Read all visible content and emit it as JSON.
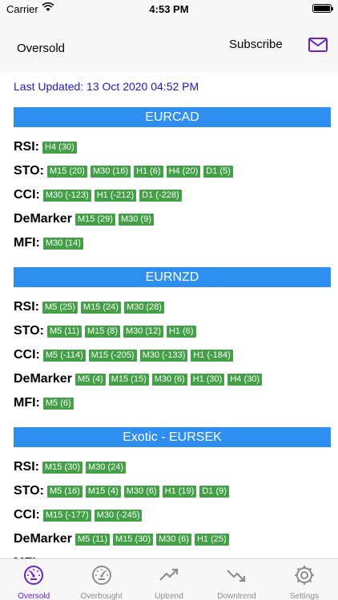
{
  "status": {
    "carrier": "Carrier",
    "time": "4:53 PM"
  },
  "nav": {
    "title": "Oversold",
    "subscribe_label": "Subscribe",
    "mail_icon": "envelope-icon"
  },
  "last_updated": "Last Updated: 13 Oct 2020 04:52 PM",
  "sections": [
    {
      "title": "EURCAD",
      "rows": [
        {
          "label": "RSI:",
          "badges": [
            "H4 (30)"
          ]
        },
        {
          "label": "STO:",
          "badges": [
            "M15 (20)",
            "M30 (16)",
            "H1 (6)",
            "H4 (20)",
            "D1 (5)"
          ]
        },
        {
          "label": "CCI:",
          "badges": [
            "M30 (-123)",
            "H1 (-212)",
            "D1 (-228)"
          ]
        },
        {
          "label": "DeMarker",
          "badges": [
            "M15 (29)",
            "M30 (9)"
          ]
        },
        {
          "label": "MFI:",
          "badges": [
            "M30 (14)"
          ]
        }
      ]
    },
    {
      "title": "EURNZD",
      "rows": [
        {
          "label": "RSI:",
          "badges": [
            "M5 (25)",
            "M15 (24)",
            "M30 (28)"
          ]
        },
        {
          "label": "STO:",
          "badges": [
            "M5 (11)",
            "M15 (8)",
            "M30 (12)",
            "H1 (6)"
          ]
        },
        {
          "label": "CCI:",
          "badges": [
            "M5 (-114)",
            "M15 (-205)",
            "M30 (-133)",
            "H1 (-184)"
          ]
        },
        {
          "label": "DeMarker",
          "badges": [
            "M5 (4)",
            "M15 (15)",
            "M30 (6)",
            "H1 (30)",
            "H4 (30)"
          ]
        },
        {
          "label": "MFI:",
          "badges": [
            "M5 (6)"
          ]
        }
      ]
    },
    {
      "title": "Exotic - EURSEK",
      "rows": [
        {
          "label": "RSI:",
          "badges": [
            "M15 (30)",
            "M30 (24)"
          ]
        },
        {
          "label": "STO:",
          "badges": [
            "M5 (16)",
            "M15 (4)",
            "M30 (6)",
            "H1 (19)",
            "D1 (9)"
          ]
        },
        {
          "label": "CCI:",
          "badges": [
            "M15 (-177)",
            "M30 (-245)"
          ]
        },
        {
          "label": "DeMarker",
          "badges": [
            "M5 (11)",
            "M15 (30)",
            "M30 (6)",
            "H1 (25)"
          ]
        },
        {
          "label": "MFI:",
          "badges": []
        }
      ]
    }
  ],
  "tabs": [
    {
      "label": "Oversold",
      "icon": "gauge-low-icon",
      "active": true
    },
    {
      "label": "Overbought",
      "icon": "gauge-high-icon",
      "active": false
    },
    {
      "label": "Uptrend",
      "icon": "trend-up-icon",
      "active": false
    },
    {
      "label": "Downtrend",
      "icon": "trend-down-icon",
      "active": false
    },
    {
      "label": "Settings",
      "icon": "gear-icon",
      "active": false
    }
  ],
  "colors": {
    "accent": "#6a21c9",
    "section_header": "#2f8ff0",
    "badge": "#43a047",
    "last_updated": "#1a1ac8"
  }
}
